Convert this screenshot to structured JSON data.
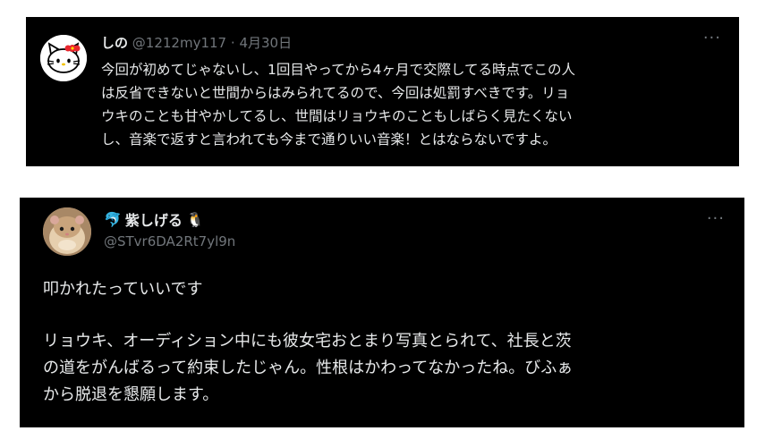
{
  "tweets": [
    {
      "display_name": "しの",
      "handle": "@1212my117",
      "separator": "·",
      "date": "4月30日",
      "more": "···",
      "lines": [
        "今回が初めてじゃないし、1回目やってから4ヶ月で交際してる時点でこの人",
        "は反省できないと世間からはみられてるので、今回は処罰すべきです。リョ",
        "ウキのことも甘やかしてるし、世間はリョウキのこともしばらく見たくない",
        "し、音楽で返すと言われても今まで通りいい音楽！とはならないですよ。"
      ]
    },
    {
      "display_name": "紫しげる",
      "name_prefix_emoji": "🐬",
      "name_suffix_emoji": "🐧",
      "handle": "@STvr6DA2Rt7yl9n",
      "more": "···",
      "lines_first": "叩かれたっていいです",
      "lines": [
        "リョウキ、オーディション中にも彼女宅おとまり写真とられて、社長と茨",
        "の道をがんばるって約束したじゃん。性根はかわってなかったね。びふぁ",
        "から脱退を懇願します。"
      ]
    }
  ],
  "colors": {
    "background": "#000000",
    "text": "#e7e9ea",
    "muted": "#71767b"
  }
}
